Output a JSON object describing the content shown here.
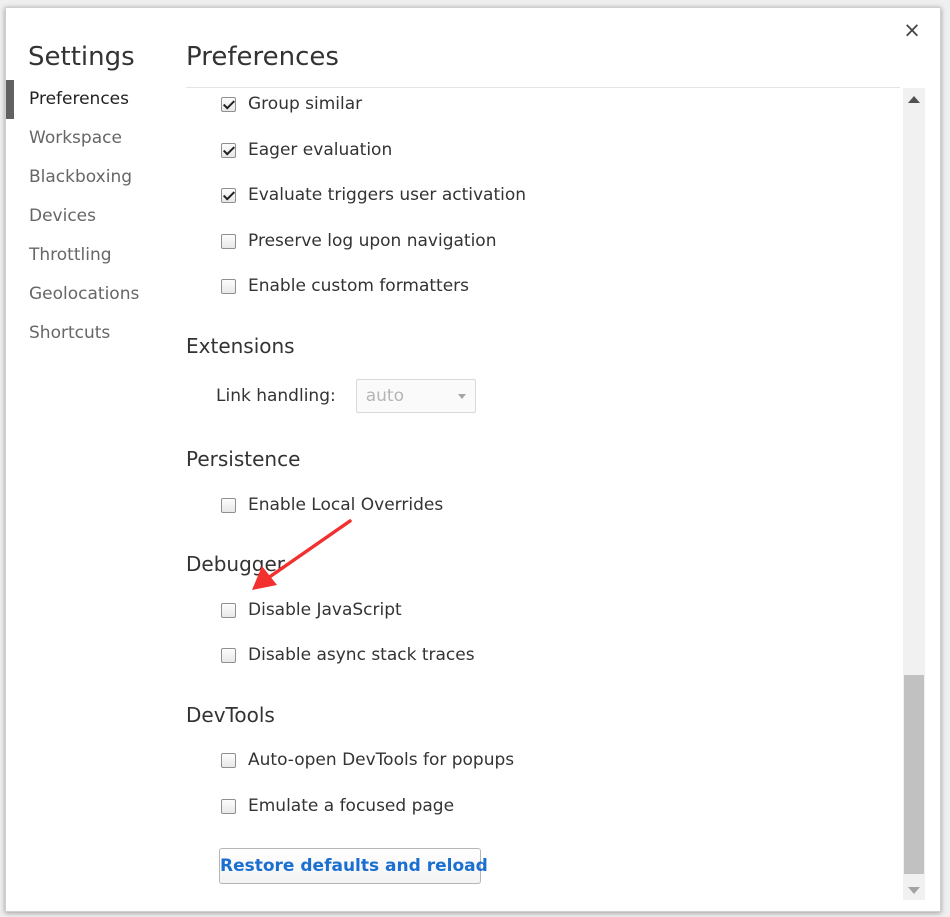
{
  "sidebar": {
    "title": "Settings",
    "items": [
      {
        "label": "Preferences",
        "selected": true
      },
      {
        "label": "Workspace"
      },
      {
        "label": "Blackboxing"
      },
      {
        "label": "Devices"
      },
      {
        "label": "Throttling"
      },
      {
        "label": "Geolocations"
      },
      {
        "label": "Shortcuts"
      }
    ]
  },
  "main": {
    "title": "Preferences",
    "console": {
      "group_similar": {
        "label": "Group similar",
        "checked": true
      },
      "eager_evaluation": {
        "label": "Eager evaluation",
        "checked": true
      },
      "evaluate_triggers": {
        "label": "Evaluate triggers user activation",
        "checked": true
      },
      "preserve_log": {
        "label": "Preserve log upon navigation",
        "checked": false
      },
      "custom_formatters": {
        "label": "Enable custom formatters",
        "checked": false
      }
    },
    "extensions": {
      "title": "Extensions",
      "link_handling_label": "Link handling:",
      "link_handling_value": "auto"
    },
    "persistence": {
      "title": "Persistence",
      "local_overrides": {
        "label": "Enable Local Overrides",
        "checked": false
      }
    },
    "debugger": {
      "title": "Debugger",
      "disable_js": {
        "label": "Disable JavaScript",
        "checked": false
      },
      "disable_async": {
        "label": "Disable async stack traces",
        "checked": false
      }
    },
    "devtools": {
      "title": "DevTools",
      "auto_open": {
        "label": "Auto-open DevTools for popups",
        "checked": false
      },
      "emulate_focus": {
        "label": "Emulate a focused page",
        "checked": false
      }
    },
    "restore_button_label": "Restore defaults and reload"
  },
  "close_glyph": "×",
  "colors": {
    "accent": "#1a6fd1",
    "annotation_arrow": "#f2302d",
    "selected_marker": "#616161"
  },
  "icons": [
    "close-icon",
    "checkbox-checked-icon",
    "checkbox-unchecked-icon",
    "dropdown-arrow-icon",
    "scroll-up-arrow-icon",
    "scroll-down-arrow-icon"
  ]
}
